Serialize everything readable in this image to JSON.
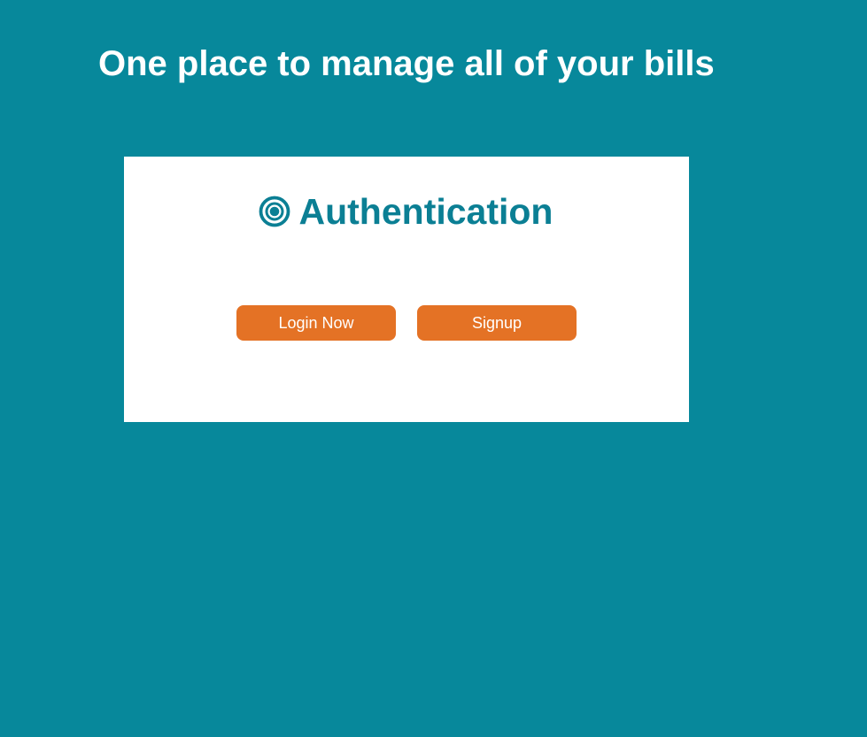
{
  "page": {
    "headline": "One place to manage all of your bills"
  },
  "auth_card": {
    "icon": "target-icon",
    "title": "Authentication",
    "login_label": "Login Now",
    "signup_label": "Signup"
  },
  "colors": {
    "background": "#07889b",
    "card": "#ffffff",
    "title": "#0b7f94",
    "button": "#e47225",
    "button_text": "#ffffff"
  }
}
